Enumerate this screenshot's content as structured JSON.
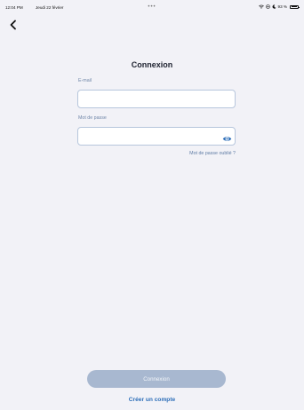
{
  "status_bar": {
    "time": "12:04 PM",
    "date": "Jeudi 22 février",
    "dots": "•••",
    "battery": "93 %",
    "battery_level": 0.93
  },
  "header": {
    "title": "Connexion"
  },
  "form": {
    "email_label": "E-mail",
    "email_value": "",
    "email_placeholder": "",
    "password_label": "Mot de passe",
    "password_value": "",
    "password_placeholder": "",
    "forgot_password": "Mot de passe oublié ?"
  },
  "actions": {
    "login_label": "Connexion",
    "create_account_label": "Créer un compte"
  },
  "colors": {
    "background": "#f2f2f7",
    "accent": "#2e6fb9",
    "disabled_button": "#a8b8d0",
    "label": "#6f86a8"
  },
  "icons": {
    "back": "chevron-left-icon",
    "password_toggle": "eye-icon",
    "wifi": "wifi-icon",
    "location": "location-icon",
    "moon": "moon-icon",
    "battery": "battery-icon"
  }
}
